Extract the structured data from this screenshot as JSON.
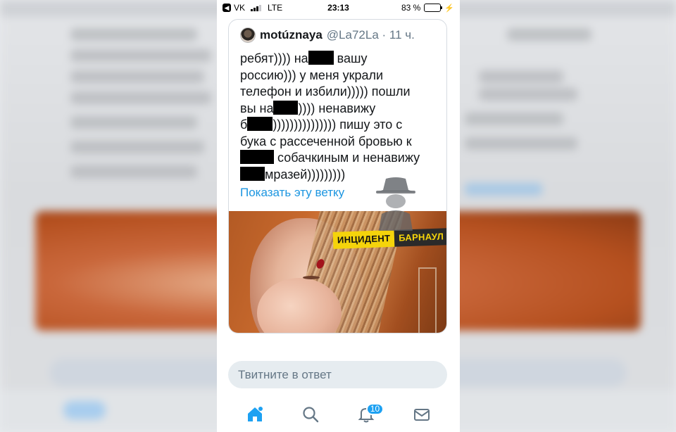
{
  "status_bar": {
    "back_app": "VK",
    "network": "LTE",
    "time": "23:13",
    "battery_percent": "83 %",
    "battery_level": 0.83
  },
  "tweet": {
    "display_name": "motúznaya",
    "handle_time": "@La72La · 11 ч.",
    "lines": [
      [
        "ребят)))) на",
        "",
        " вашу"
      ],
      [
        "россию))) у меня украли"
      ],
      [
        "телефон и избили))))) пошли"
      ],
      [
        "вы на",
        "",
        ")))) ненавижу"
      ],
      [
        "б",
        "",
        "))))))))))))))) пишу это с"
      ],
      [
        "бука с рассеченной бровью к"
      ],
      [
        "",
        "",
        " собачкиным и ненавижу"
      ],
      [
        "",
        "",
        "мразей)))))))))"
      ]
    ],
    "show_thread": "Показать эту ветку"
  },
  "photo": {
    "watermark_left": "ИНЦИДЕНТ",
    "watermark_right": "БАРНАУЛ"
  },
  "reply": {
    "placeholder": "Твитните в ответ"
  },
  "tabbar": {
    "home_icon": "home-icon",
    "search_icon": "search-icon",
    "notifications_icon": "bell-icon",
    "notifications_count": "10",
    "messages_icon": "envelope-icon"
  },
  "colors": {
    "link": "#1b95e0",
    "accent": "#1da1f2",
    "muted": "#657786",
    "watermark_yellow": "#f5d40b"
  }
}
